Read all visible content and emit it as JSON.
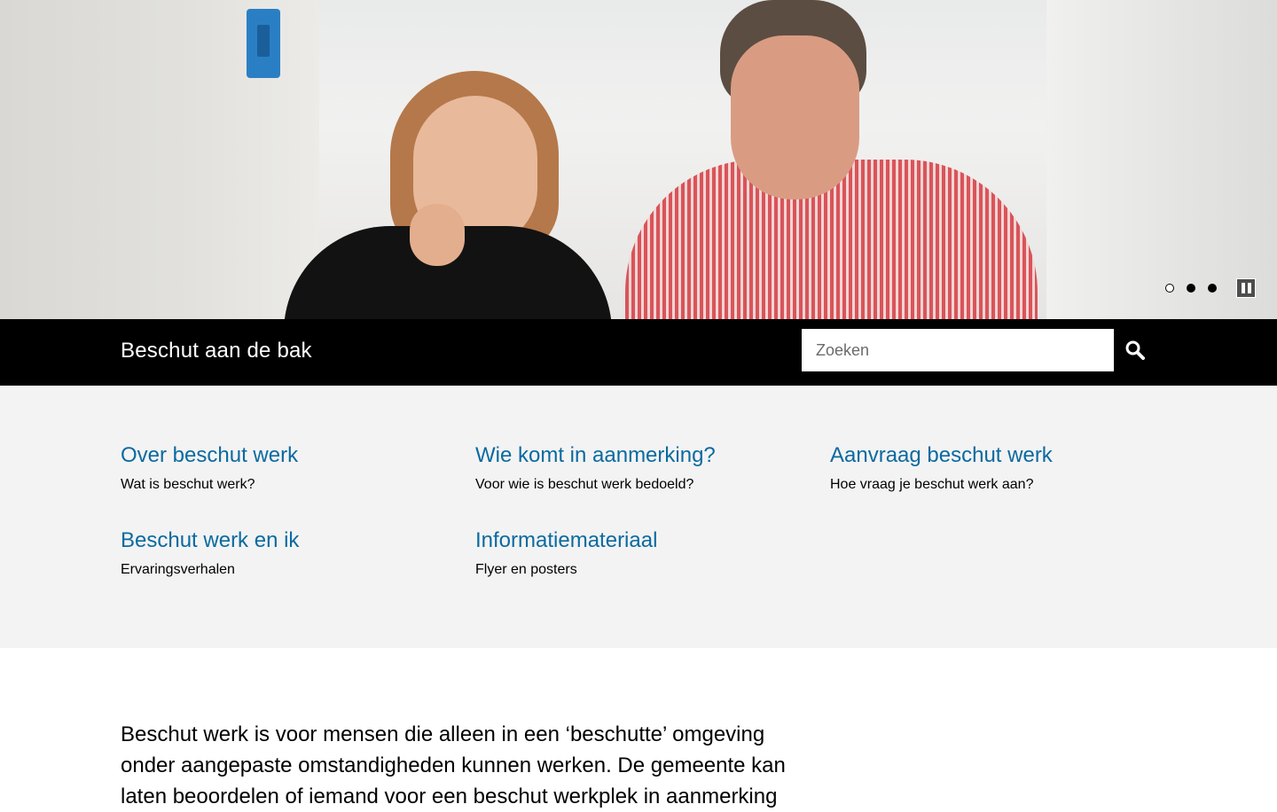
{
  "hero": {
    "slides": [
      {
        "label": "1",
        "active": true
      },
      {
        "label": "2",
        "active": false
      },
      {
        "label": "3",
        "active": false
      }
    ],
    "pause_icon": "pause-icon"
  },
  "header": {
    "title": "Beschut aan de bak",
    "search_placeholder": "Zoeken",
    "search_icon": "magnifier-icon"
  },
  "nav": {
    "items": [
      {
        "heading": "Over beschut werk",
        "sub": "Wat is beschut werk?"
      },
      {
        "heading": "Wie komt in aanmerking?",
        "sub": "Voor wie is beschut werk bedoeld?"
      },
      {
        "heading": "Aanvraag beschut werk",
        "sub": "Hoe vraag je beschut werk aan?"
      },
      {
        "heading": "Beschut werk en ik",
        "sub": "Ervaringsverhalen"
      },
      {
        "heading": "Informatiemateriaal",
        "sub": "Flyer en posters"
      }
    ]
  },
  "intro": {
    "text": "Beschut werk is voor mensen die alleen in een ‘beschutte’ omgeving onder aangepaste omstandigheden kunnen werken. De gemeente kan laten beoordelen of iemand voor een beschut werkplek in aanmerking"
  },
  "colors": {
    "link": "#0b6aa0",
    "bar": "#000000",
    "nav_bg": "#f3f3f3"
  }
}
